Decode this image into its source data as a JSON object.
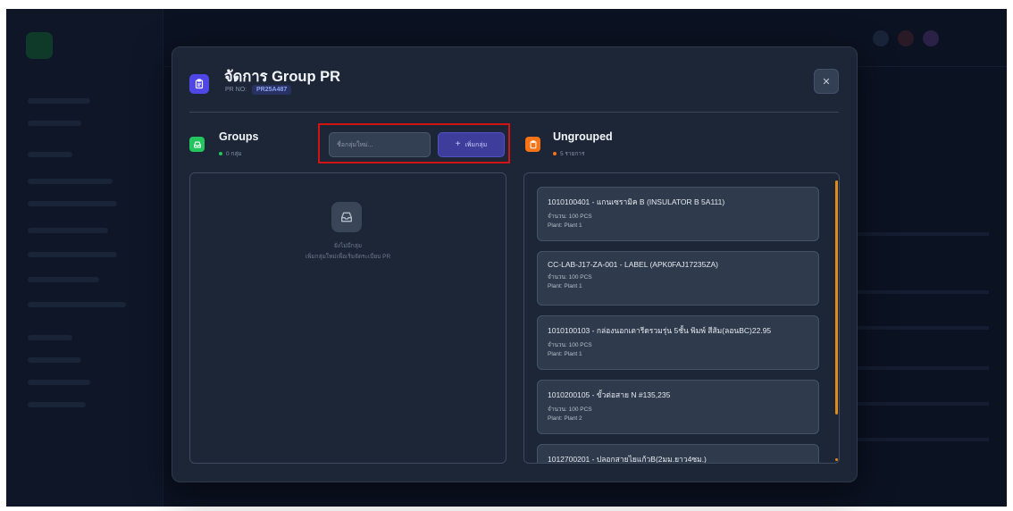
{
  "modal": {
    "title": "จัดการ Group PR",
    "pr_no_label": "PR NO:",
    "pr_no_value": "PR25A487",
    "close_label": "✕"
  },
  "groups": {
    "title": "Groups",
    "count": "0 กลุ่ม",
    "input_placeholder": "ชื่อกลุ่มใหม่...",
    "add_button": "เพิ่มกลุ่ม",
    "empty_title": "ยังไม่มีกลุ่ม",
    "empty_subtitle": "เพิ่มกลุ่มใหม่เพื่อเริ่มจัดระเบียบ PR"
  },
  "ungrouped": {
    "title": "Ungrouped",
    "count": "5 รายการ",
    "items": [
      {
        "title": "1010100401 - แกนเซรามิค B (INSULATOR B 5A111)",
        "qty": "จำนวน: 100 PCS",
        "plant": "Plant: Plant 1"
      },
      {
        "title": "CC-LAB-J17-ZA-001 - LABEL (APK0FAJ17235ZA)",
        "qty": "จำนวน: 100 PCS",
        "plant": "Plant: Plant 1"
      },
      {
        "title": "1010100103 - กล่องนอกเตารีดรวมรุ่น 5ชั้น พิมพ์ สีส้ม(ลอนBC)22.95",
        "qty": "จำนวน: 100 PCS",
        "plant": "Plant: Plant 1"
      },
      {
        "title": "1010200105 - ขั้วต่อสาย N #135,235",
        "qty": "จำนวน: 100 PCS",
        "plant": "Plant: Plant 2"
      },
      {
        "title": "1012700201 - ปลอกสายไยแก้วB(2มม.ยาว4ซม.)",
        "qty": "",
        "plant": ""
      }
    ]
  },
  "colors": {
    "accent": "#4f46e5",
    "groups_green": "#22c55e",
    "ungrouped_orange": "#f97316",
    "highlight_red": "#d21414"
  },
  "icons": {
    "title": "clipboard-icon",
    "groups": "inbox-icon",
    "ungrouped": "clipboard-icon",
    "empty": "inbox-icon",
    "close": "close-icon",
    "add": "plus-icon"
  }
}
